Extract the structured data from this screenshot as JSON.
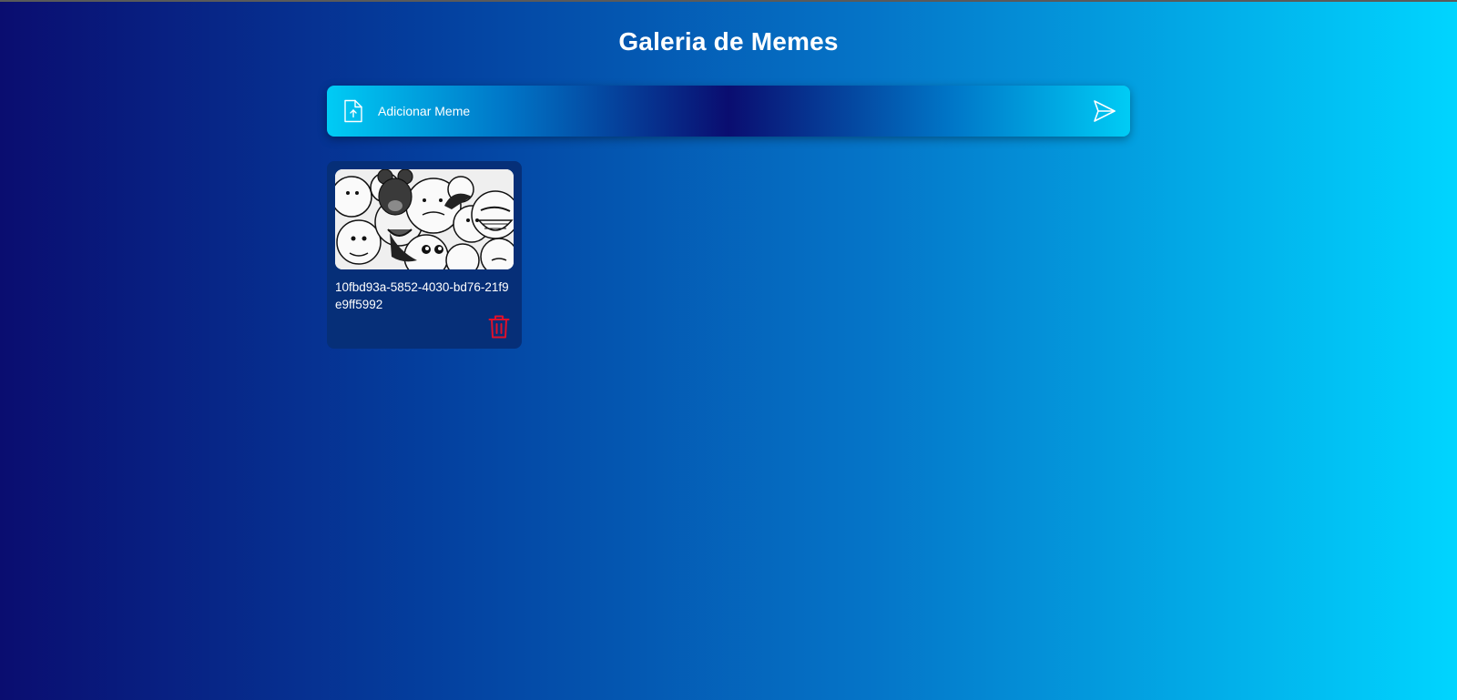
{
  "header": {
    "title": "Galeria de Memes"
  },
  "upload": {
    "label": "Adicionar Meme",
    "icon": "file-upload-icon",
    "send_icon": "send-icon"
  },
  "memes": [
    {
      "name": "10fbd93a-5852-4030-bd76-21f9e9ff5992",
      "delete_icon": "trash-icon"
    }
  ],
  "colors": {
    "gradient_start": "#0a0d70",
    "gradient_end": "#00d5ff",
    "card_bg": "#062f78",
    "delete_red": "#e0102a"
  }
}
